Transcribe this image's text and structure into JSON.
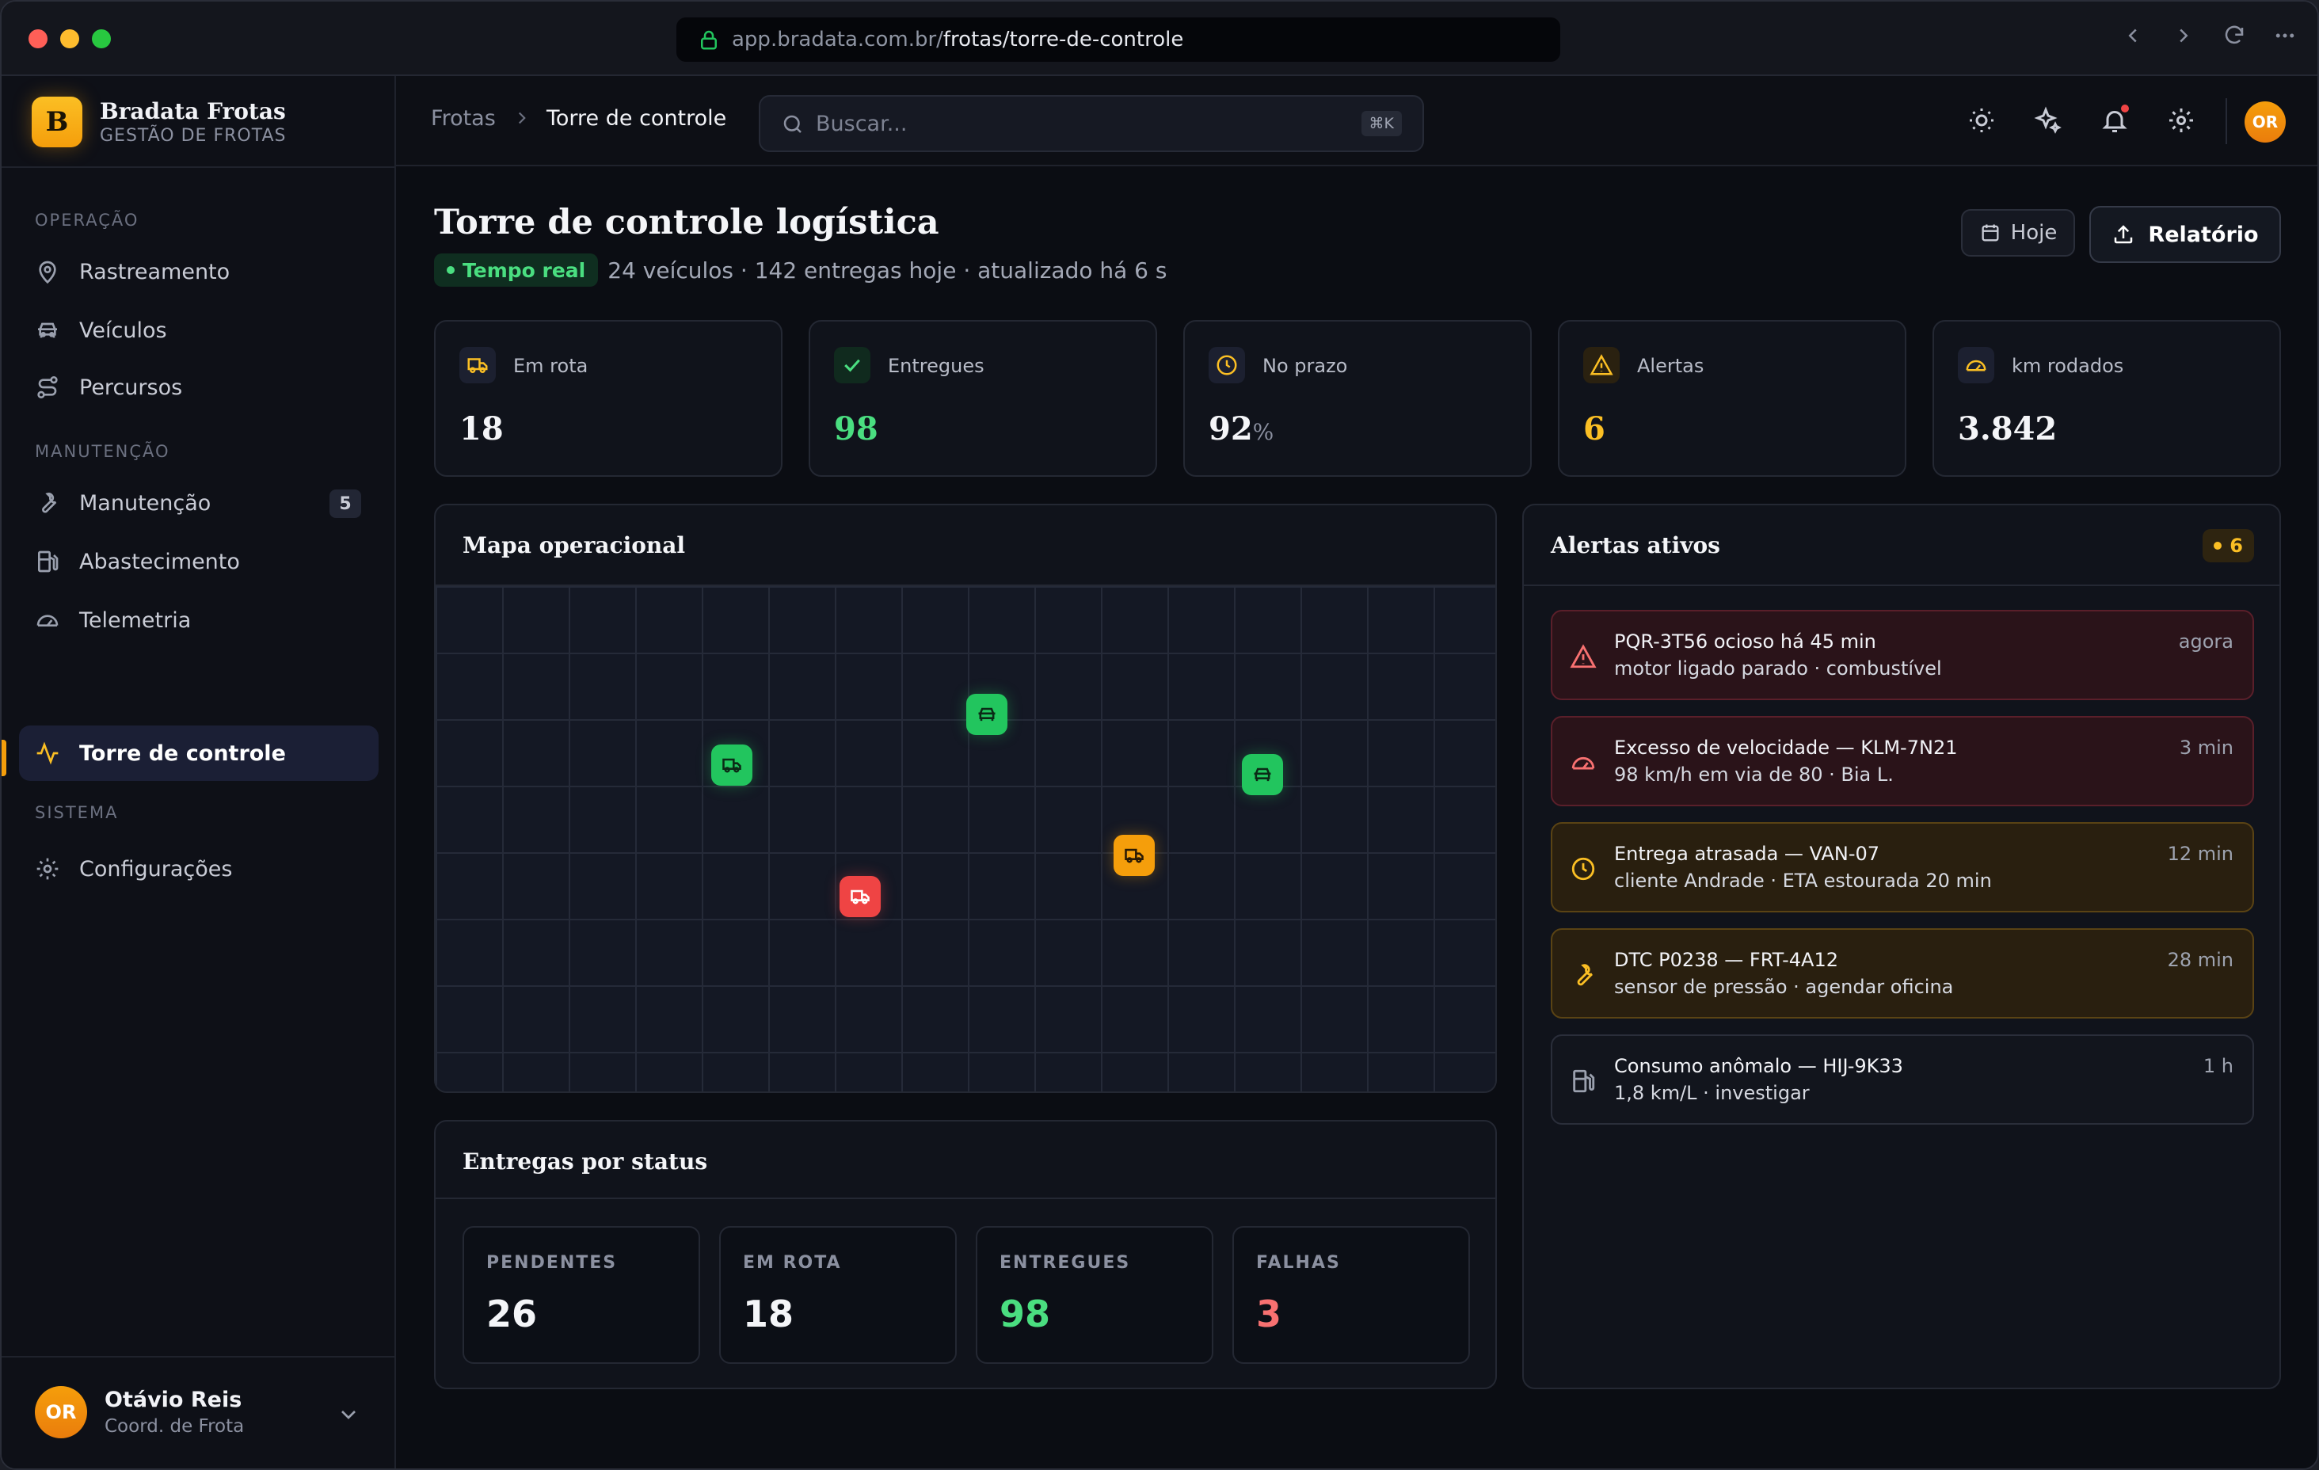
{
  "browser": {
    "url_host": "app.bradata.com.br/",
    "url_path": "frotas/torre-de-controle"
  },
  "brand": {
    "logo_letter": "B",
    "name": "Bradata Frotas",
    "subtitle": "GESTÃO DE FROTAS"
  },
  "sidebar": {
    "sections": [
      {
        "label": "OPERAÇÃO"
      },
      {
        "label": "MANUTENÇÃO"
      },
      {
        "label": "SISTEMA"
      }
    ],
    "items": [
      {
        "label": "Rastreamento",
        "icon": "map-pin-icon"
      },
      {
        "label": "Veículos",
        "icon": "car-icon"
      },
      {
        "label": "Percursos",
        "icon": "route-icon"
      },
      {
        "label": "Manutenção",
        "icon": "wrench-icon",
        "badge": "5"
      },
      {
        "label": "Abastecimento",
        "icon": "fuel-icon"
      },
      {
        "label": "Telemetria",
        "icon": "gauge-icon"
      },
      {
        "label": "Torre de controle",
        "icon": "activity-icon",
        "active": true
      },
      {
        "label": "Configurações",
        "icon": "gear-icon"
      }
    ],
    "user": {
      "initials": "OR",
      "name": "Otávio Reis",
      "role": "Coord. de Frota"
    }
  },
  "topbar": {
    "breadcrumb": [
      "Frotas",
      "Torre de controle"
    ],
    "search_placeholder": "Buscar...",
    "search_shortcut": "⌘K",
    "avatar_initials": "OR"
  },
  "page": {
    "title": "Torre de controle logística",
    "live_label": "Tempo real",
    "subtitle": "24 veículos · 142 entregas hoje · atualizado há 6 s",
    "today_button": "Hoje",
    "report_button": "Relatório"
  },
  "kpis": [
    {
      "label": "Em rota",
      "value": "18",
      "unit": "",
      "icon": "truck-icon",
      "color": "#fbbf24",
      "value_color": "#f4f5f8"
    },
    {
      "label": "Entregues",
      "value": "98",
      "unit": "",
      "icon": "check-icon",
      "color": "#4ade80",
      "value_color": "#4ade80"
    },
    {
      "label": "No prazo",
      "value": "92",
      "unit": "%",
      "icon": "clock-icon",
      "color": "#fbbf24",
      "value_color": "#f4f5f8"
    },
    {
      "label": "Alertas",
      "value": "6",
      "unit": "",
      "icon": "warning-icon",
      "color": "#fbbf24",
      "value_color": "#fbbf24"
    },
    {
      "label": "km rodados",
      "value": "3.842",
      "unit": "",
      "icon": "gauge-icon",
      "color": "#fbbf24",
      "value_color": "#f4f5f8"
    }
  ],
  "map": {
    "title": "Mapa operacional",
    "vehicles": [
      {
        "type": "truck",
        "status": "green"
      },
      {
        "type": "car",
        "status": "green"
      },
      {
        "type": "car",
        "status": "green"
      },
      {
        "type": "truck",
        "status": "amber"
      },
      {
        "type": "truck",
        "status": "red"
      }
    ]
  },
  "deliveries": {
    "title": "Entregas por status",
    "statuses": [
      {
        "label": "PENDENTES",
        "value": "26",
        "color": "#f4f5f8"
      },
      {
        "label": "EM ROTA",
        "value": "18",
        "color": "#f4f5f8"
      },
      {
        "label": "ENTREGUES",
        "value": "98",
        "color": "#4ade80"
      },
      {
        "label": "FALHAS",
        "value": "3",
        "color": "#f87171"
      }
    ]
  },
  "alerts": {
    "title": "Alertas ativos",
    "count": "6",
    "items": [
      {
        "title": "PQR-3T56 ocioso há 45 min",
        "desc": "motor ligado parado · combustível",
        "time": "agora",
        "severity": "red",
        "icon": "warning-icon"
      },
      {
        "title": "Excesso de velocidade — KLM-7N21",
        "desc": "98 km/h em via de 80 · Bia L.",
        "time": "3 min",
        "severity": "red",
        "icon": "gauge-icon"
      },
      {
        "title": "Entrega atrasada — VAN-07",
        "desc": "cliente Andrade · ETA estourada 20 min",
        "time": "12 min",
        "severity": "amber",
        "icon": "clock-icon"
      },
      {
        "title": "DTC P0238 — FRT-4A12",
        "desc": "sensor de pressão · agendar oficina",
        "time": "28 min",
        "severity": "amber",
        "icon": "wrench-icon"
      },
      {
        "title": "Consumo anômalo — HIJ-9K33",
        "desc": "1,8 km/L · investigar",
        "time": "1 h",
        "severity": "gray",
        "icon": "fuel-icon"
      }
    ]
  }
}
